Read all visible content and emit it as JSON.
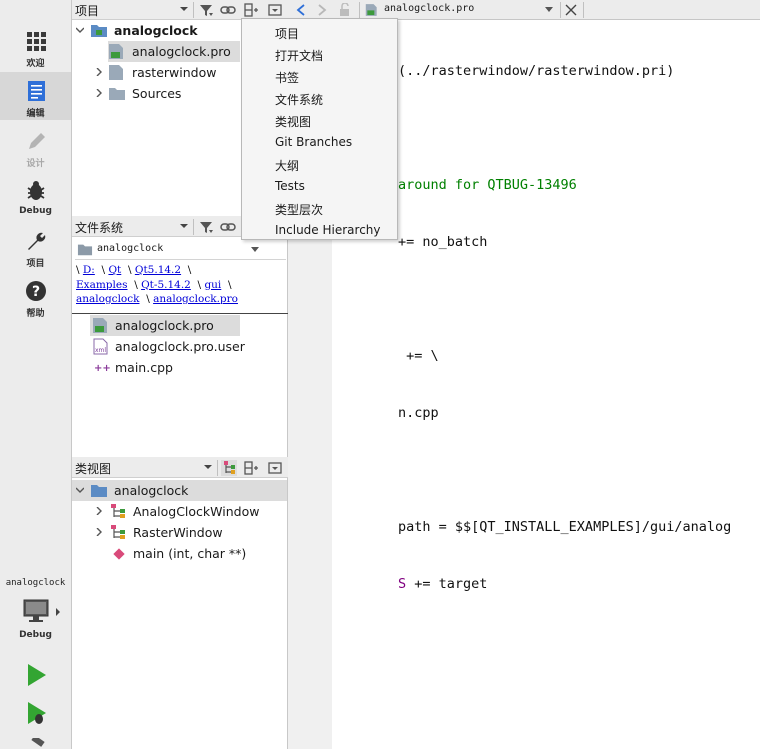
{
  "modes": [
    {
      "label": "欢迎"
    },
    {
      "label": "编辑"
    },
    {
      "label": "设计"
    },
    {
      "label": "Debug"
    },
    {
      "label": "项目"
    },
    {
      "label": "帮助"
    }
  ],
  "kit": {
    "project": "analogclock",
    "config": "Debug"
  },
  "projects_pane": {
    "title": "项目",
    "tree": [
      {
        "label": "analogclock"
      },
      {
        "label": "analogclock.pro"
      },
      {
        "label": "rasterwindow"
      },
      {
        "label": "Sources"
      }
    ]
  },
  "menu": {
    "items": [
      "项目",
      "打开文档",
      "书签",
      "文件系统",
      "类视图",
      "Git Branches",
      "大纲",
      "Tests",
      "类型层次",
      "Include Hierarchy"
    ]
  },
  "fs_pane": {
    "title": "文件系统",
    "combo": "analogclock",
    "crumbs": {
      "sep": "\\",
      "parts": [
        "D:",
        "Qt",
        "Qt5.14.2",
        "Examples",
        "Qt-5.14.2",
        "gui",
        "analogclock",
        "analogclock.pro"
      ]
    },
    "files": [
      "analogclock.pro",
      "analogclock.pro.user",
      "main.cpp"
    ]
  },
  "class_pane": {
    "title": "类视图",
    "tree": [
      {
        "label": "analogclock"
      },
      {
        "label": "AnalogClockWindow"
      },
      {
        "label": "RasterWindow"
      },
      {
        "label": "main (int, char **)"
      }
    ]
  },
  "editor": {
    "tab": "analogclock.pro",
    "lines": [
      {
        "plain": "(../rasterwindow/rasterwindow.pri)"
      },
      {
        "plain": ""
      },
      {
        "green": "around for QTBUG-13496"
      },
      {
        "plain": "+= no_batch"
      },
      {
        "plain": ""
      },
      {
        "plain": " += \\"
      },
      {
        "plain": "n.cpp"
      },
      {
        "plain": ""
      },
      {
        "plain": "path = $$[QT_INSTALL_EXAMPLES]/gui/analog"
      },
      {
        "purple": "S",
        "plain": " += target"
      }
    ]
  },
  "colors": {
    "accent": "#2e6fd8",
    "run": "#33a532",
    "folder": "#5b8bc4",
    "code_green": "#008000",
    "code_purple": "#800080"
  }
}
